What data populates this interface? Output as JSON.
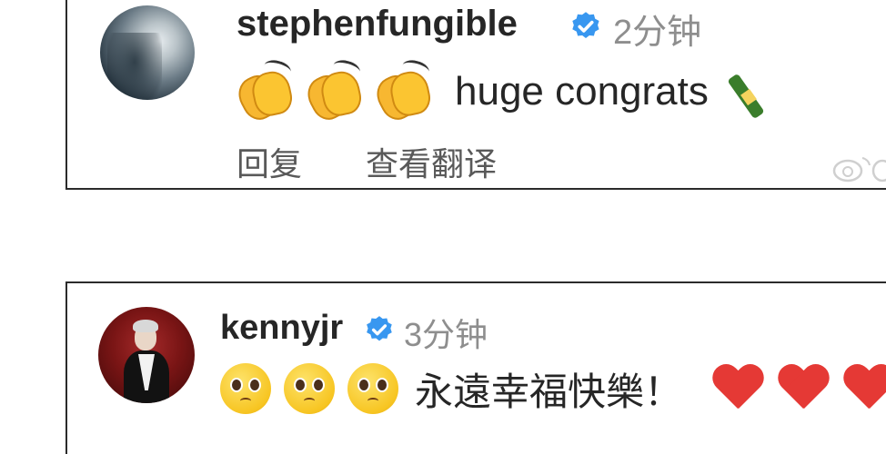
{
  "comments": [
    {
      "username": "stephenfungible",
      "time": "2分钟",
      "text": "huge congrats",
      "actions": {
        "reply": "回复",
        "translate": "查看翻译"
      },
      "emoji_before": "clapping-hands",
      "emoji_after": "champagne-bottle"
    },
    {
      "username": "kennyjr",
      "time": "3分钟",
      "text": "永遠幸福快樂！",
      "emoji_before": "pleading-face",
      "emoji_after": "red-heart"
    }
  ],
  "colors": {
    "verified": "#3897f0",
    "heart": "#e53935",
    "muted": "#8e8e8e"
  }
}
